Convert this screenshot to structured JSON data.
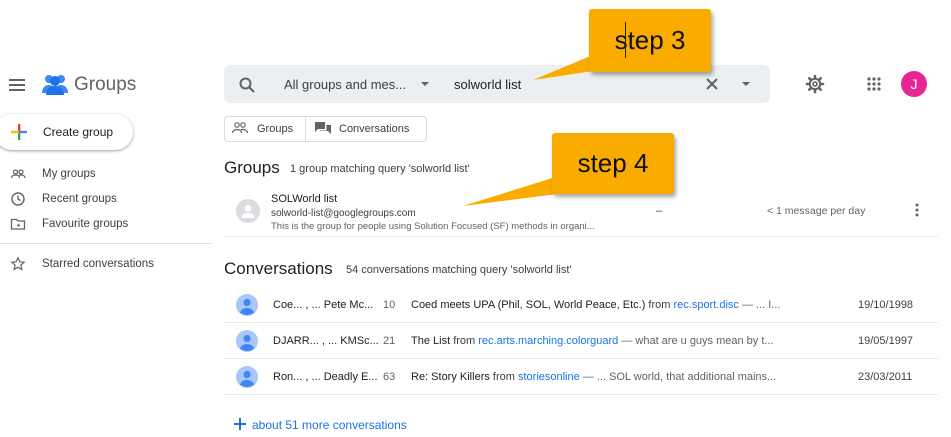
{
  "header": {
    "app_name": "Groups",
    "search": {
      "scope": "All groups and mes...",
      "query": "solworld list"
    },
    "avatar_initial": "J"
  },
  "sidebar": {
    "create_label": "Create group",
    "items": [
      {
        "label": "My groups",
        "icon": "people-icon"
      },
      {
        "label": "Recent groups",
        "icon": "clock-icon"
      },
      {
        "label": "Favourite groups",
        "icon": "folder-star-icon"
      },
      {
        "label": "Starred conversations",
        "icon": "star-icon"
      }
    ]
  },
  "filters": {
    "groups_label": "Groups",
    "conversations_label": "Conversations"
  },
  "groups_section": {
    "title": "Groups",
    "subtitle": "1 group matching query 'solworld list'",
    "results": [
      {
        "name": "SOLWorld list",
        "email": "solworld-list@googlegroups.com",
        "description": "This is the group for people using Solution Focused (SF) methods in organi...",
        "members": "–",
        "activity": "< 1 message per day"
      }
    ]
  },
  "conversations_section": {
    "title": "Conversations",
    "subtitle": "54 conversations matching query 'solworld list'",
    "rows": [
      {
        "authors": "Coe... , ... Pete Mc...",
        "count": "10",
        "subject": "Coed meets UPA (Phil, SOL, World Peace, Etc.)",
        "from_word": "from",
        "group": "rec.sport.disc",
        "snippet": " — ... I...",
        "date": "19/10/1998"
      },
      {
        "authors": "DJARR... , ... KMSc...",
        "count": "21",
        "subject": "The List",
        "from_word": "from",
        "group": "rec.arts.marching.colorguard",
        "snippet": " — what are u guys mean by t...",
        "date": "19/05/1997"
      },
      {
        "authors": "Ron... , ... Deadly E...",
        "count": "63",
        "subject": "Re: Story Killers",
        "from_word": "from",
        "group": "storiesonline",
        "snippet": " — ... SOL world, that additional mains...",
        "date": "23/03/2011"
      }
    ],
    "more_label": "about 51 more conversations"
  },
  "callouts": {
    "step3": "step 3",
    "step4": "step 4"
  },
  "colors": {
    "accent": "#1a73e8",
    "avatar": "#e52592",
    "callout": "#f9ab00",
    "search_bg": "#eceff1"
  }
}
